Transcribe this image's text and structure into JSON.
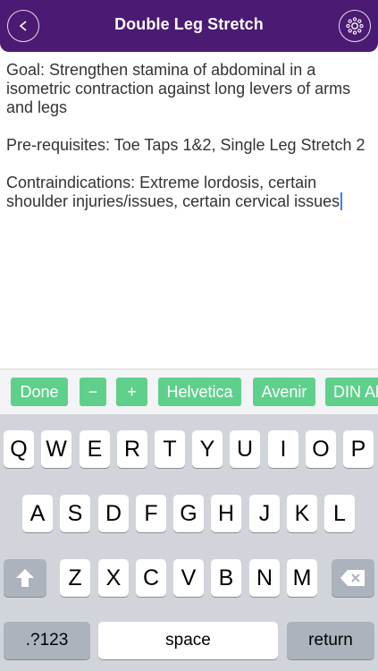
{
  "header": {
    "title": "Double Leg Stretch",
    "back_icon": "back-arrow-icon",
    "settings_icon": "gear-icon"
  },
  "content": {
    "goal": "Goal: Strengthen stamina of abdominal in a isometric contraction against long levers of arms and legs",
    "prerequisites": "Pre-requisites: Toe Taps 1&2, Single Leg Stretch 2",
    "contraindications": "Contraindications: Extreme lordosis, certain shoulder injuries/issues, certain cervical issues"
  },
  "toolbar": {
    "done": "Done",
    "minus": "−",
    "plus": "+",
    "font1": "Helvetica",
    "font2": "Avenir",
    "font3": "DIN Al"
  },
  "keyboard": {
    "row1": [
      "Q",
      "W",
      "E",
      "R",
      "T",
      "Y",
      "U",
      "I",
      "O",
      "P"
    ],
    "row2": [
      "A",
      "S",
      "D",
      "F",
      "G",
      "H",
      "J",
      "K",
      "L"
    ],
    "row3": [
      "Z",
      "X",
      "C",
      "V",
      "B",
      "N",
      "M"
    ],
    "numbers_key": ".?123",
    "space_key": "space",
    "return_key": "return",
    "shift_icon": "shift-arrow-icon",
    "delete_icon": "backspace-icon"
  },
  "colors": {
    "header": "#4b1a72",
    "toolbar_button": "#5fd08c",
    "caret": "#3b7bff"
  }
}
